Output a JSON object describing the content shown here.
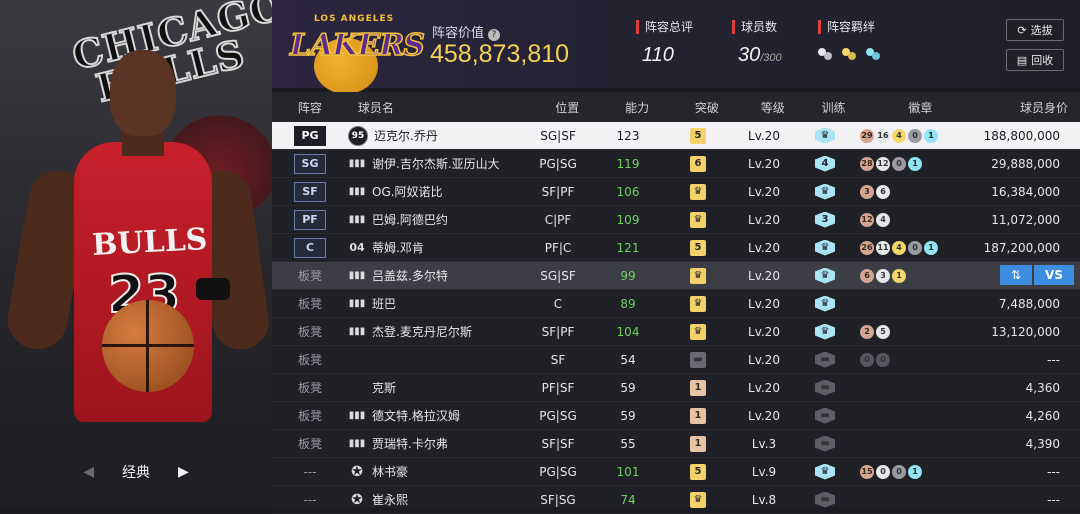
{
  "left_panel": {
    "team_text_1": "CHICAGO",
    "team_text_2": "BULLS",
    "jersey_text": "BULLS",
    "jersey_number": "23",
    "ball_text": "SPALDING",
    "classic_label": "经典",
    "prev_arrow": "◀",
    "next_arrow": "▶"
  },
  "header": {
    "team_logo_top": "LOS ANGELES",
    "team_logo_word": "LAKERS",
    "lineup_value_label": "阵容价值",
    "help_icon": "?",
    "lineup_value": "458,873,810",
    "overall_label": "阵容总评",
    "overall_value": "110",
    "player_count_label": "球员数",
    "player_count_value": "30",
    "player_count_max": "/300",
    "bond_label": "阵容羁绊",
    "select_button": "选拔",
    "recycle_button": "回收",
    "colors": {
      "accent": "#e0403a",
      "gold": "#f5d156"
    }
  },
  "table": {
    "headers": {
      "lineup": "阵容",
      "name": "球员名",
      "role": "位置",
      "ability": "能力",
      "breakthrough": "突破",
      "level": "等级",
      "training": "训练",
      "badges": "徽章",
      "value": "球员身价"
    },
    "rows": [
      {
        "pos": "PG",
        "icon": "95",
        "name": "迈克尔.乔丹",
        "role": "SG|SF",
        "ability": "123",
        "brk": "5",
        "level": "Lv.20",
        "train": "",
        "badges": [
          "29",
          "16",
          "4",
          "0",
          "1"
        ],
        "value": "188,800,000"
      },
      {
        "pos": "SG",
        "icon": "bars",
        "name": "谢伊.吉尔杰斯.亚历山大",
        "role": "PG|SG",
        "ability": "119",
        "brk": "6",
        "level": "Lv.20",
        "train": "4",
        "badges": [
          "28",
          "12",
          "0",
          "1"
        ],
        "value": "29,888,000"
      },
      {
        "pos": "SF",
        "icon": "bars",
        "name": "OG.阿奴诺比",
        "role": "SF|PF",
        "ability": "106",
        "brk": "",
        "level": "Lv.20",
        "train": "",
        "badges": [
          "3",
          "6"
        ],
        "value": "16,384,000"
      },
      {
        "pos": "PF",
        "icon": "bars",
        "name": "巴姆.阿德巴约",
        "role": "C|PF",
        "ability": "109",
        "brk": "",
        "level": "Lv.20",
        "train": "3",
        "badges": [
          "12",
          "4"
        ],
        "value": "11,072,000"
      },
      {
        "pos": "C",
        "icon": "04",
        "name": "蒂姆.邓肯",
        "role": "PF|C",
        "ability": "121",
        "brk": "5",
        "level": "Lv.20",
        "train": "",
        "badges": [
          "26",
          "11",
          "4",
          "0",
          "1"
        ],
        "value": "187,200,000"
      },
      {
        "pos": "板凳",
        "icon": "bars",
        "name": "吕盖兹.多尔特",
        "role": "SG|SF",
        "ability": "99",
        "brk": "",
        "level": "Lv.20",
        "train": "",
        "badges": [
          "6",
          "3",
          "1"
        ],
        "value": "",
        "swap_label": "⇅",
        "vs_label": "VS"
      },
      {
        "pos": "板凳",
        "icon": "bars",
        "name": "班巴",
        "role": "C",
        "ability": "89",
        "brk": "",
        "level": "Lv.20",
        "train": "",
        "badges": [],
        "value": "7,488,000"
      },
      {
        "pos": "板凳",
        "icon": "bars",
        "name": "杰登.麦克丹尼尔斯",
        "role": "SF|PF",
        "ability": "104",
        "brk": "",
        "level": "Lv.20",
        "train": "",
        "badges": [
          "2",
          "5"
        ],
        "value": "13,120,000"
      },
      {
        "pos": "板凳",
        "icon": "",
        "name": "",
        "role": "SF",
        "ability": "54",
        "brk": "",
        "level": "Lv.20",
        "train": "",
        "badges": [
          "0",
          "0"
        ],
        "value": "---"
      },
      {
        "pos": "板凳",
        "icon": "",
        "name": "克斯",
        "role": "PF|SF",
        "ability": "59",
        "brk": "1",
        "level": "Lv.20",
        "train": "",
        "badges": [],
        "value": "4,360"
      },
      {
        "pos": "板凳",
        "icon": "bars",
        "name": "德文特.格拉汉姆",
        "role": "PG|SG",
        "ability": "59",
        "brk": "1",
        "level": "Lv.20",
        "train": "",
        "badges": [],
        "value": "4,260"
      },
      {
        "pos": "板凳",
        "icon": "bars",
        "name": "贾瑞特.卡尔弗",
        "role": "SF|SF",
        "ability": "55",
        "brk": "1",
        "level": "Lv.3",
        "train": "",
        "badges": [],
        "value": "4,390"
      },
      {
        "pos": "---",
        "icon": "star",
        "name": "林书豪",
        "role": "PG|SG",
        "ability": "101",
        "brk": "5",
        "level": "Lv.9",
        "train": "",
        "badges": [
          "15",
          "0",
          "0",
          "1"
        ],
        "value": "---"
      },
      {
        "pos": "---",
        "icon": "star",
        "name": "崔永熙",
        "role": "SF|SG",
        "ability": "74",
        "brk": "",
        "level": "Lv.8",
        "train": "",
        "badges": [],
        "value": "---"
      }
    ]
  }
}
